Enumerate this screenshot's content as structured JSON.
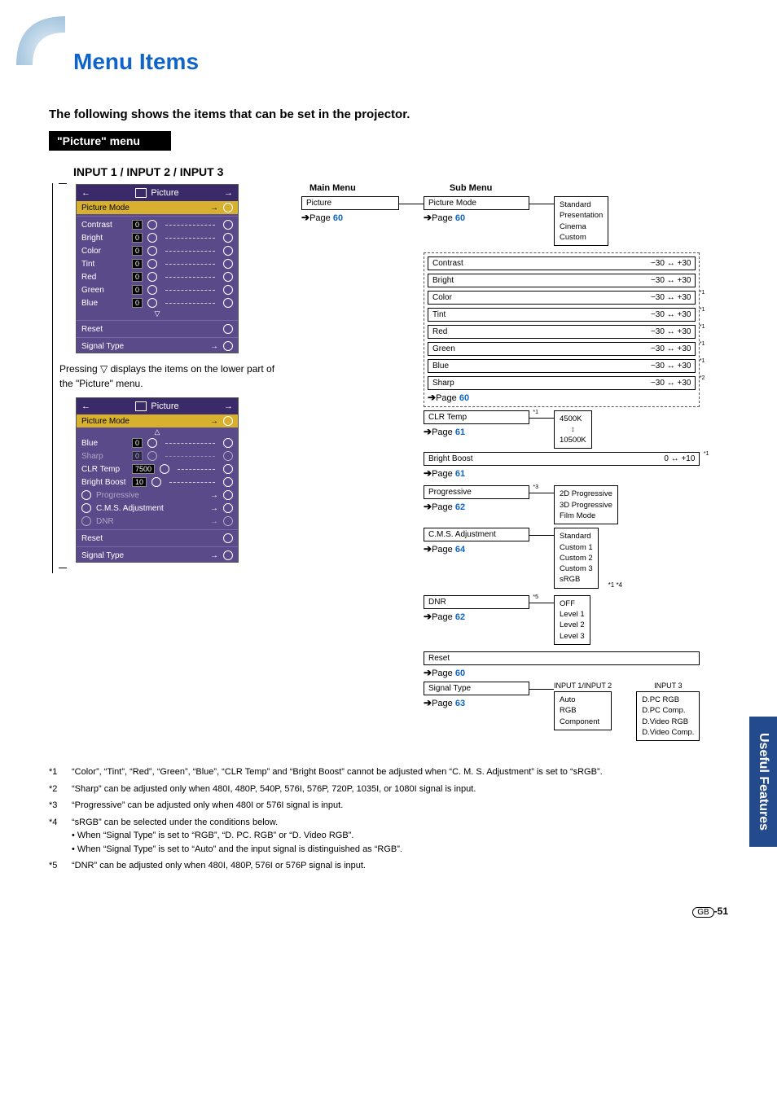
{
  "page_title": "Menu Items",
  "intro": "The following shows the items that can be set in the projector.",
  "picture_menu_label": "\"Picture\" menu",
  "inputs_heading": "INPUT 1 / INPUT 2 / INPUT 3",
  "osd": {
    "title": "Picture",
    "rows1": [
      {
        "label": "Picture Mode",
        "sel": true
      },
      {
        "label": "Contrast",
        "val": "0"
      },
      {
        "label": "Bright",
        "val": "0"
      },
      {
        "label": "Color",
        "val": "0"
      },
      {
        "label": "Tint",
        "val": "0"
      },
      {
        "label": "Red",
        "val": "0"
      },
      {
        "label": "Green",
        "val": "0"
      },
      {
        "label": "Blue",
        "val": "0"
      }
    ],
    "reset": "Reset",
    "signal_type": "Signal Type",
    "rows2": [
      {
        "label": "Picture Mode",
        "sel": true
      },
      {
        "label": "Blue",
        "val": "0"
      },
      {
        "label": "Sharp",
        "val": "0",
        "dim": true
      },
      {
        "label": "CLR Temp",
        "val": "7500"
      },
      {
        "label": "Bright Boost",
        "val": "10"
      }
    ],
    "progressive": "Progressive",
    "cms": "C.M.S. Adjustment",
    "dnr": "DNR"
  },
  "left_note_prefix": "Pressing ",
  "left_note_suffix": " displays the items on the lower part of the \"Picture\" menu.",
  "main_menu_head": "Main Menu",
  "sub_menu_head": "Sub Menu",
  "nodes": {
    "picture": {
      "label": "Picture",
      "page": "60"
    },
    "picture_mode": {
      "label": "Picture Mode",
      "page": "60",
      "options": [
        "Standard",
        "Presentation",
        "Cinema",
        "Custom"
      ]
    },
    "contrast": {
      "label": "Contrast",
      "range": "−30 ↔ +30"
    },
    "bright": {
      "label": "Bright",
      "range": "−30 ↔ +30"
    },
    "color": {
      "label": "Color",
      "range": "−30 ↔ +30",
      "sup": "*1"
    },
    "tint": {
      "label": "Tint",
      "range": "−30 ↔ +30",
      "sup": "*1"
    },
    "red": {
      "label": "Red",
      "range": "−30 ↔ +30",
      "sup": "*1"
    },
    "green": {
      "label": "Green",
      "range": "−30 ↔ +30",
      "sup": "*1"
    },
    "blue": {
      "label": "Blue",
      "range": "−30 ↔ +30",
      "sup": "*1"
    },
    "sharp": {
      "label": "Sharp",
      "range": "−30 ↔ +30",
      "sup": "*2",
      "page": "60"
    },
    "clr_temp": {
      "label": "CLR Temp",
      "page": "61",
      "sup": "*1",
      "opt_top": "4500K",
      "opt_bot": "10500K"
    },
    "bright_boost": {
      "label": "Bright Boost",
      "range": "0 ↔ +10",
      "page": "61",
      "sup": "*1"
    },
    "progressive": {
      "label": "Progressive",
      "page": "62",
      "sup": "*3",
      "options": [
        "2D Progressive",
        "3D Progressive",
        "Film Mode"
      ]
    },
    "cms": {
      "label": "C.M.S. Adjustment",
      "page": "64",
      "options": [
        "Standard",
        "Custom 1",
        "Custom 2",
        "Custom 3",
        "sRGB"
      ],
      "opt_sup": "*1 *4"
    },
    "dnr": {
      "label": "DNR",
      "page": "62",
      "sup": "*5",
      "options": [
        "OFF",
        "Level 1",
        "Level 2",
        "Level 3"
      ]
    },
    "reset": {
      "label": "Reset",
      "page": "60"
    },
    "signal_type": {
      "label": "Signal Type",
      "page": "63"
    }
  },
  "signal_cols": {
    "head1": "INPUT 1/INPUT 2",
    "head2": "INPUT 3",
    "col1": [
      "Auto",
      "RGB",
      "Component"
    ],
    "col2": [
      "D.PC RGB",
      "D.PC Comp.",
      "D.Video RGB",
      "D.Video Comp."
    ]
  },
  "page_str": "Page",
  "footnotes": {
    "f1": "“Color”, “Tint”, “Red”, “Green”, “Blue”, “CLR Temp” and “Bright Boost” cannot be adjusted when “C. M. S. Adjustment” is set to “sRGB”.",
    "f2": "“Sharp” can be adjusted only when 480I, 480P, 540P, 576I, 576P, 720P, 1035I, or 1080I signal is input.",
    "f3": "“Progressive” can be adjusted only when 480I or 576I signal is input.",
    "f4": "“sRGB” can be selected under the conditions below.",
    "f4a": "• When “Signal Type” is set to “RGB”, “D. PC. RGB” or “D. Video RGB”.",
    "f4b": "• When “Signal Type” is set to “Auto” and the input signal is distinguished as “RGB”.",
    "f5": "“DNR” can be adjusted only when 480I, 480P, 576I or 576P signal is input."
  },
  "side_tab": "Useful Features",
  "gb_label": "GB",
  "page_number": "-51"
}
